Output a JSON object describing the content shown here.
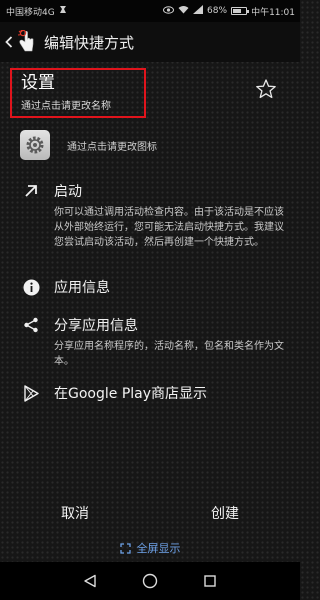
{
  "status_bar": {
    "carrier": "中国移动4G",
    "battery_percent": "68%",
    "battery_level": 0.68,
    "time": "中午11:01"
  },
  "action_bar": {
    "title": "编辑快捷方式"
  },
  "shortcut": {
    "name": "设置",
    "name_hint": "通过点击请更改名称",
    "icon_hint": "通过点击请更改图标"
  },
  "sections": {
    "launch": {
      "label": "启动",
      "description": "你可以通过调用活动检查内容。由于该活动是不应该从外部始终运行，您可能无法启动快捷方式。我建议您尝试启动该活动，然后再创建一个快捷方式。"
    },
    "app_info": {
      "label": "应用信息"
    },
    "share": {
      "label": "分享应用信息",
      "description": "分享应用名称程序的，活动名称，包名和类名作为文本。"
    },
    "play": {
      "label": "在Google Play商店显示"
    }
  },
  "buttons": {
    "cancel": "取消",
    "create": "创建",
    "fullscreen": "全屏显示"
  },
  "colors": {
    "highlight_border": "#e0141c",
    "link": "#6ea2e8"
  }
}
